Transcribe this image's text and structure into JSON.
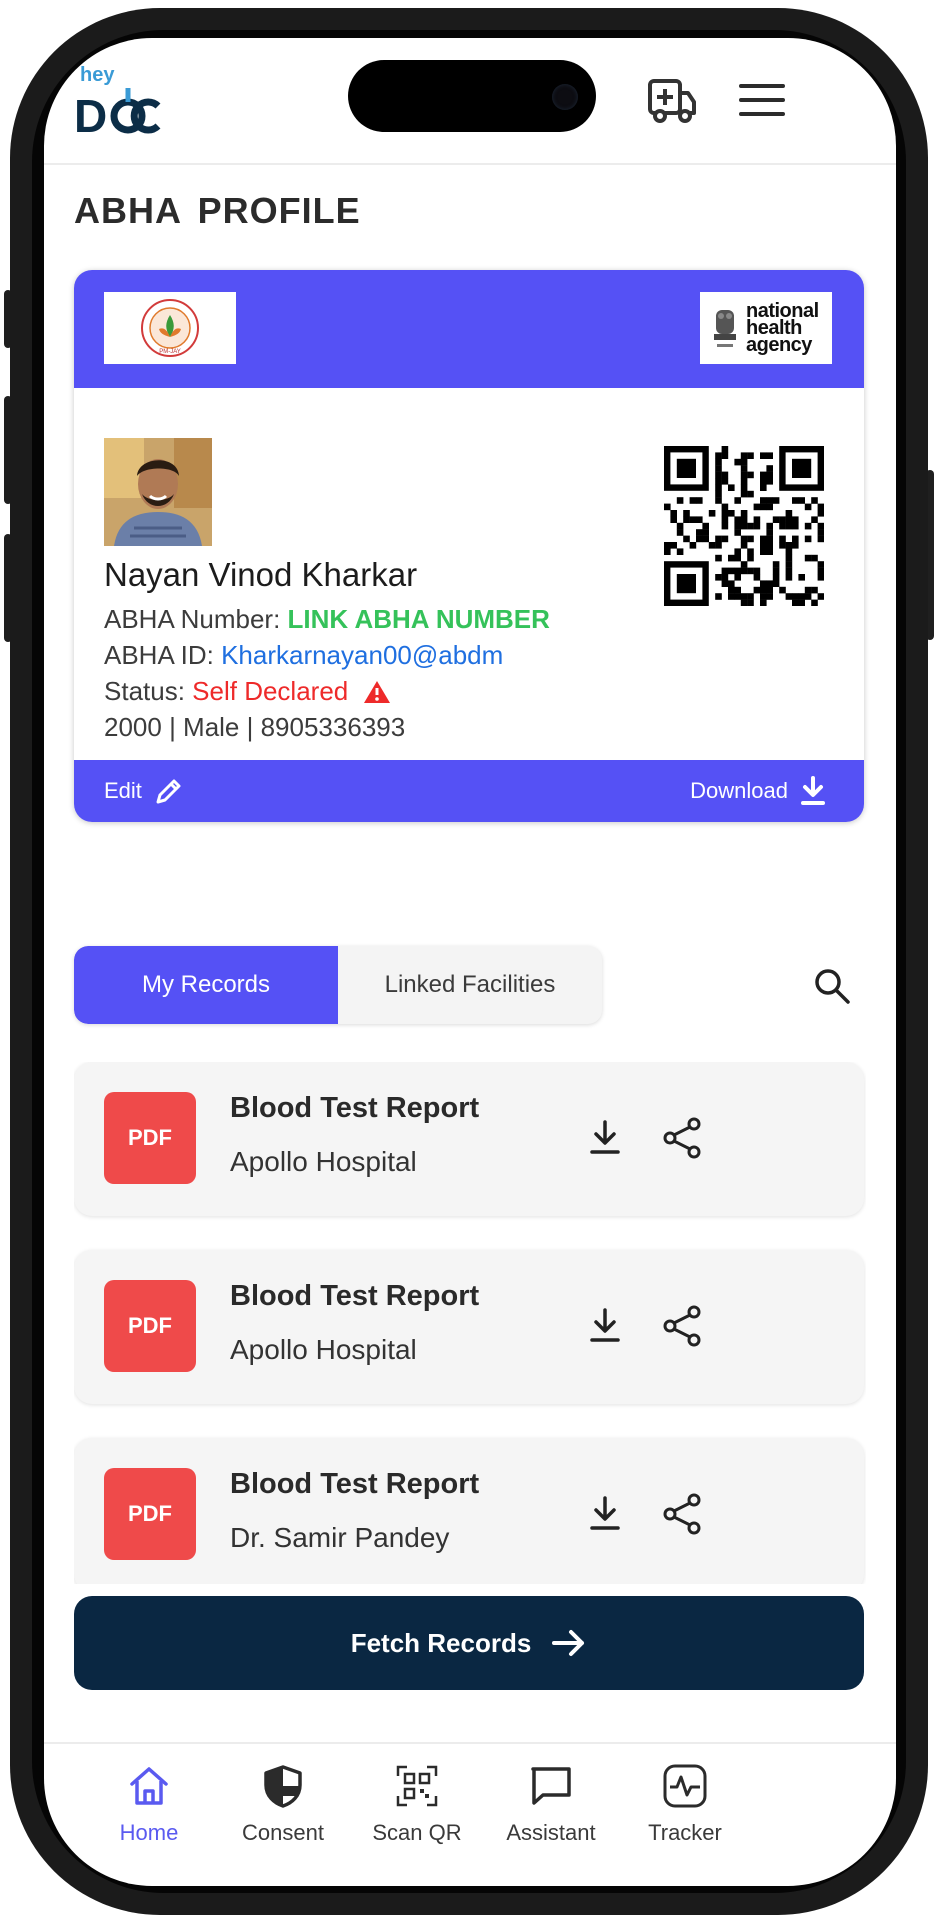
{
  "header": {
    "logo_small": "hey",
    "logo_main": "DOC"
  },
  "page": {
    "title": "ABHA PROFILE"
  },
  "card": {
    "left_logo_text": "PM-JAY",
    "right_logo_text": [
      "national",
      "health",
      "agency"
    ],
    "name": "Nayan Vinod Kharkar",
    "abha_number_label": "ABHA Number:",
    "abha_number_value": "LINK ABHA NUMBER",
    "abha_id_label": "ABHA ID:",
    "abha_id_value": "Kharkarnayan00@abdm",
    "status_label": "Status:",
    "status_value": "Self Declared",
    "details": "2000 | Male | 8905336393",
    "edit_label": "Edit",
    "download_label": "Download",
    "colors": {
      "brand": "#5551f5",
      "green": "#35c25a",
      "blue": "#1f6fe0",
      "red": "#ee2a2a"
    }
  },
  "tabs": [
    {
      "label": "My Records",
      "active": true
    },
    {
      "label": "Linked Facilities",
      "active": false
    }
  ],
  "records": [
    {
      "type": "PDF",
      "title": "Blood Test Report",
      "source": "Apollo Hospital"
    },
    {
      "type": "PDF",
      "title": "Blood Test Report",
      "source": "Apollo Hospital"
    },
    {
      "type": "PDF",
      "title": "Blood Test Report",
      "source": "Dr. Samir Pandey"
    }
  ],
  "fetch_button": {
    "label": "Fetch Records",
    "color": "#0a2742"
  },
  "bottom_nav": [
    {
      "label": "Home",
      "icon": "home-icon",
      "active": true
    },
    {
      "label": "Consent",
      "icon": "shield-icon",
      "active": false
    },
    {
      "label": "Scan QR",
      "icon": "qr-scan-icon",
      "active": false
    },
    {
      "label": "Assistant",
      "icon": "chat-icon",
      "active": false
    },
    {
      "label": "Tracker",
      "icon": "pulse-icon",
      "active": false
    }
  ]
}
